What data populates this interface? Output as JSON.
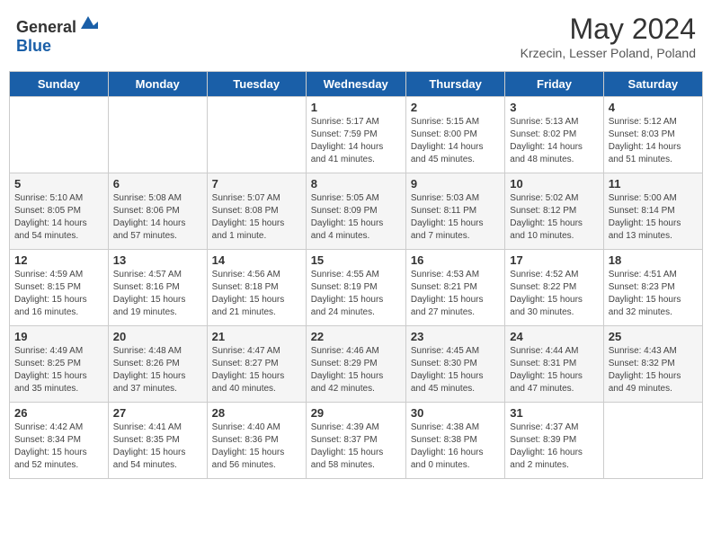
{
  "header": {
    "logo_general": "General",
    "logo_blue": "Blue",
    "title": "May 2024",
    "subtitle": "Krzecin, Lesser Poland, Poland"
  },
  "days_of_week": [
    "Sunday",
    "Monday",
    "Tuesday",
    "Wednesday",
    "Thursday",
    "Friday",
    "Saturday"
  ],
  "weeks": [
    [
      {
        "day": "",
        "info": ""
      },
      {
        "day": "",
        "info": ""
      },
      {
        "day": "",
        "info": ""
      },
      {
        "day": "1",
        "info": "Sunrise: 5:17 AM\nSunset: 7:59 PM\nDaylight: 14 hours\nand 41 minutes."
      },
      {
        "day": "2",
        "info": "Sunrise: 5:15 AM\nSunset: 8:00 PM\nDaylight: 14 hours\nand 45 minutes."
      },
      {
        "day": "3",
        "info": "Sunrise: 5:13 AM\nSunset: 8:02 PM\nDaylight: 14 hours\nand 48 minutes."
      },
      {
        "day": "4",
        "info": "Sunrise: 5:12 AM\nSunset: 8:03 PM\nDaylight: 14 hours\nand 51 minutes."
      }
    ],
    [
      {
        "day": "5",
        "info": "Sunrise: 5:10 AM\nSunset: 8:05 PM\nDaylight: 14 hours\nand 54 minutes."
      },
      {
        "day": "6",
        "info": "Sunrise: 5:08 AM\nSunset: 8:06 PM\nDaylight: 14 hours\nand 57 minutes."
      },
      {
        "day": "7",
        "info": "Sunrise: 5:07 AM\nSunset: 8:08 PM\nDaylight: 15 hours\nand 1 minute."
      },
      {
        "day": "8",
        "info": "Sunrise: 5:05 AM\nSunset: 8:09 PM\nDaylight: 15 hours\nand 4 minutes."
      },
      {
        "day": "9",
        "info": "Sunrise: 5:03 AM\nSunset: 8:11 PM\nDaylight: 15 hours\nand 7 minutes."
      },
      {
        "day": "10",
        "info": "Sunrise: 5:02 AM\nSunset: 8:12 PM\nDaylight: 15 hours\nand 10 minutes."
      },
      {
        "day": "11",
        "info": "Sunrise: 5:00 AM\nSunset: 8:14 PM\nDaylight: 15 hours\nand 13 minutes."
      }
    ],
    [
      {
        "day": "12",
        "info": "Sunrise: 4:59 AM\nSunset: 8:15 PM\nDaylight: 15 hours\nand 16 minutes."
      },
      {
        "day": "13",
        "info": "Sunrise: 4:57 AM\nSunset: 8:16 PM\nDaylight: 15 hours\nand 19 minutes."
      },
      {
        "day": "14",
        "info": "Sunrise: 4:56 AM\nSunset: 8:18 PM\nDaylight: 15 hours\nand 21 minutes."
      },
      {
        "day": "15",
        "info": "Sunrise: 4:55 AM\nSunset: 8:19 PM\nDaylight: 15 hours\nand 24 minutes."
      },
      {
        "day": "16",
        "info": "Sunrise: 4:53 AM\nSunset: 8:21 PM\nDaylight: 15 hours\nand 27 minutes."
      },
      {
        "day": "17",
        "info": "Sunrise: 4:52 AM\nSunset: 8:22 PM\nDaylight: 15 hours\nand 30 minutes."
      },
      {
        "day": "18",
        "info": "Sunrise: 4:51 AM\nSunset: 8:23 PM\nDaylight: 15 hours\nand 32 minutes."
      }
    ],
    [
      {
        "day": "19",
        "info": "Sunrise: 4:49 AM\nSunset: 8:25 PM\nDaylight: 15 hours\nand 35 minutes."
      },
      {
        "day": "20",
        "info": "Sunrise: 4:48 AM\nSunset: 8:26 PM\nDaylight: 15 hours\nand 37 minutes."
      },
      {
        "day": "21",
        "info": "Sunrise: 4:47 AM\nSunset: 8:27 PM\nDaylight: 15 hours\nand 40 minutes."
      },
      {
        "day": "22",
        "info": "Sunrise: 4:46 AM\nSunset: 8:29 PM\nDaylight: 15 hours\nand 42 minutes."
      },
      {
        "day": "23",
        "info": "Sunrise: 4:45 AM\nSunset: 8:30 PM\nDaylight: 15 hours\nand 45 minutes."
      },
      {
        "day": "24",
        "info": "Sunrise: 4:44 AM\nSunset: 8:31 PM\nDaylight: 15 hours\nand 47 minutes."
      },
      {
        "day": "25",
        "info": "Sunrise: 4:43 AM\nSunset: 8:32 PM\nDaylight: 15 hours\nand 49 minutes."
      }
    ],
    [
      {
        "day": "26",
        "info": "Sunrise: 4:42 AM\nSunset: 8:34 PM\nDaylight: 15 hours\nand 52 minutes."
      },
      {
        "day": "27",
        "info": "Sunrise: 4:41 AM\nSunset: 8:35 PM\nDaylight: 15 hours\nand 54 minutes."
      },
      {
        "day": "28",
        "info": "Sunrise: 4:40 AM\nSunset: 8:36 PM\nDaylight: 15 hours\nand 56 minutes."
      },
      {
        "day": "29",
        "info": "Sunrise: 4:39 AM\nSunset: 8:37 PM\nDaylight: 15 hours\nand 58 minutes."
      },
      {
        "day": "30",
        "info": "Sunrise: 4:38 AM\nSunset: 8:38 PM\nDaylight: 16 hours\nand 0 minutes."
      },
      {
        "day": "31",
        "info": "Sunrise: 4:37 AM\nSunset: 8:39 PM\nDaylight: 16 hours\nand 2 minutes."
      },
      {
        "day": "",
        "info": ""
      }
    ]
  ]
}
